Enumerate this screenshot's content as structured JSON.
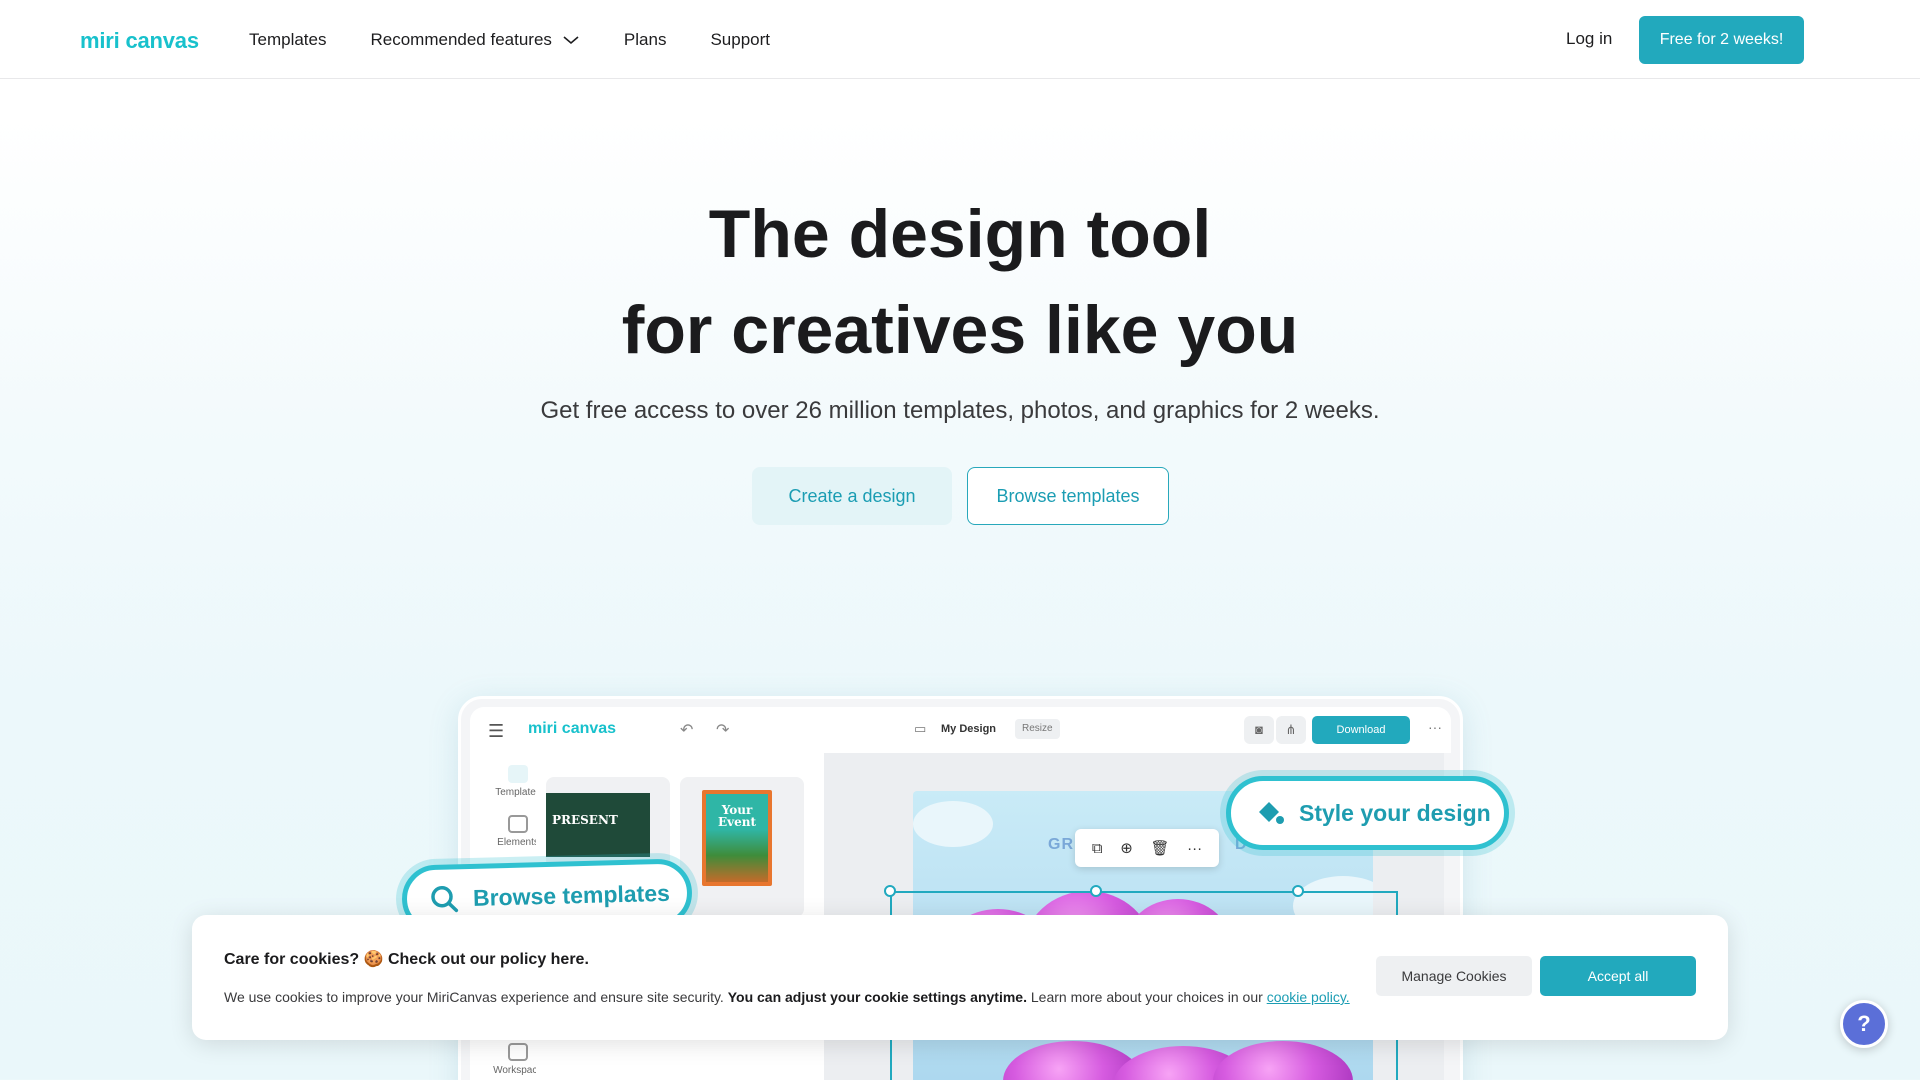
{
  "header": {
    "logo": "miri canvas",
    "nav": [
      {
        "label": "Templates"
      },
      {
        "label": "Recommended features"
      },
      {
        "label": "Plans"
      },
      {
        "label": "Support"
      }
    ],
    "login": "Log in",
    "cta": "Free for 2 weeks!"
  },
  "hero": {
    "title_line1": "The design tool",
    "title_line2": "for creatives like you",
    "subtitle": "Get free access to over 26 million templates, photos, and graphics for 2 weeks.",
    "create_button": "Create a design",
    "browse_button": "Browse templates"
  },
  "mockup": {
    "logo": "miri canvas",
    "doc_title": "My Design",
    "resize": "Resize",
    "download": "Download",
    "side": [
      {
        "label": "Templates"
      },
      {
        "label": "Elements"
      },
      {
        "label": "Workspace"
      }
    ],
    "thumb_green_text": "PRESENT",
    "thumb_orange_text": "Your Event",
    "canvas_text_left": "GR",
    "canvas_text_right": "D",
    "pill_browse": "Browse templates",
    "pill_style": "Style your design"
  },
  "cookie": {
    "title": "Care for cookies? 🍪 Check out our policy here.",
    "text_plain": "We use cookies to improve your MiriCanvas experience and ensure site security. ",
    "text_bold": "You can adjust your cookie settings anytime.",
    "text_plain2": " Learn more about your choices in our ",
    "link": "cookie policy.",
    "manage": "Manage Cookies",
    "accept": "Accept all"
  },
  "help_icon": "?",
  "colors": {
    "brand": "#22a9bd",
    "logo": "#18c1cc"
  }
}
